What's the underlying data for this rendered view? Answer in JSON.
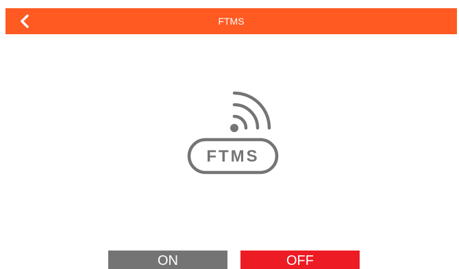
{
  "header": {
    "title": "FTMS",
    "back_icon": "chevron-left-icon",
    "color": "#ff5a22"
  },
  "main": {
    "icon": "ftms-wireless-icon",
    "icon_label": "FTMS",
    "icon_color": "#747474"
  },
  "buttons": {
    "on_label": "ON",
    "off_label": "OFF",
    "on_color": "#747474",
    "off_color": "#ed1c24"
  }
}
